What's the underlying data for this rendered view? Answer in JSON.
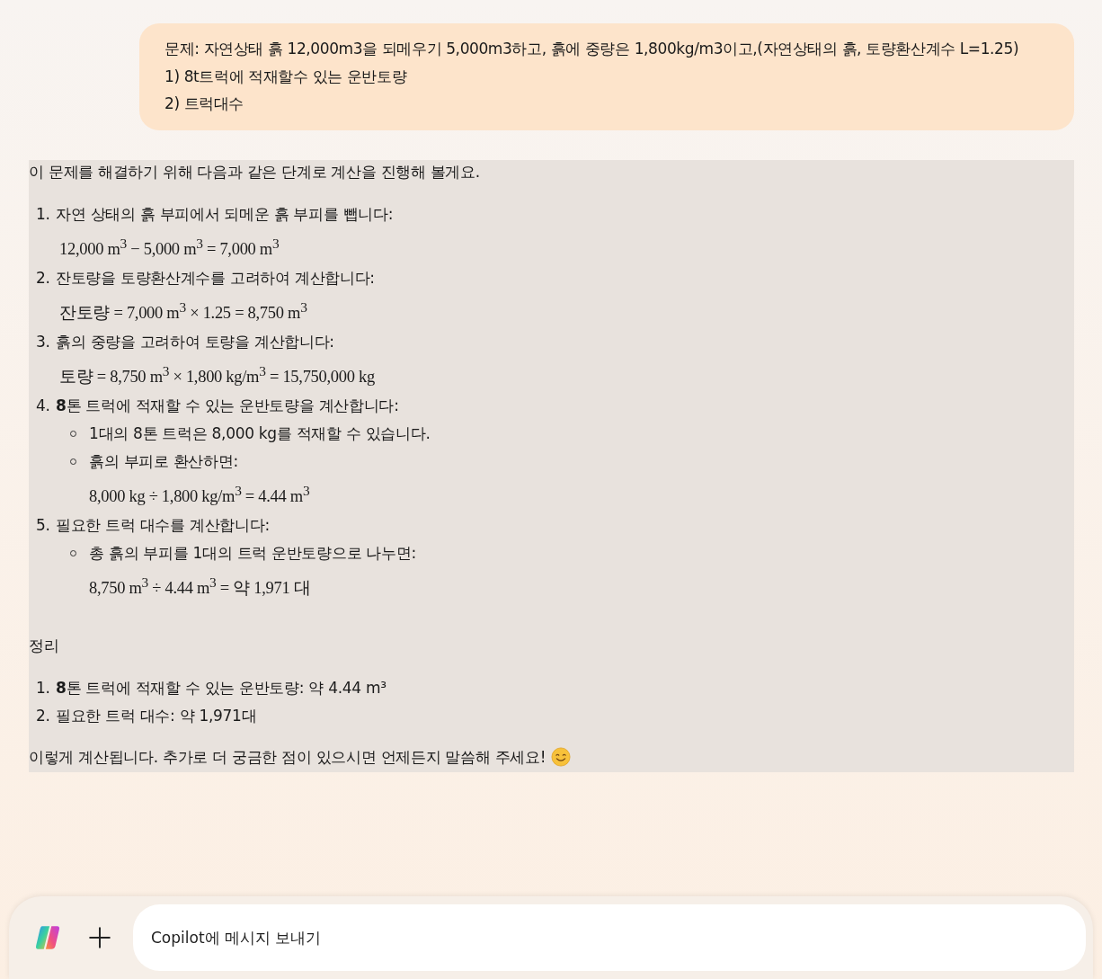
{
  "user_message": {
    "lines": [
      "문제: 자연상태 흙 12,000m3을 되메우기 5,000m3하고, 흙에 중량은 1,800kg/m3이고,(자연상태의 흙, 토량환산계수 L=1.25)",
      "1) 8t트럭에 적재할수 있는 운반토량",
      "2) 트럭대수"
    ]
  },
  "response": {
    "intro": "이 문제를 해결하기 위해 다음과 같은 단계로 계산을 진행해 볼게요.",
    "steps": [
      {
        "number": "1.",
        "text": "자연 상태의 흙 부피에서 되메운 흙 부피를 뺍니다:",
        "formula": "12,000 m$^{3}$ − 5,000 m$^{3}$ = 7,000 m$^{3}$"
      },
      {
        "number": "2.",
        "text": "잔토량을 토량환산계수를 고려하여 계산합니다:",
        "formula": "잔토량 = 7,000 m$^{3}$ × 1.25 = 8,750 m$^{3}$"
      },
      {
        "number": "3.",
        "text": "흙의 중량을 고려하여 토량을 계산합니다:",
        "formula": "토량 = 8,750 m$^{3}$ × 1,800 kg/m$^{3}$ = 15,750,000 kg"
      },
      {
        "number": "4.",
        "text": "**8**톤 트럭에 적재할 수 있는 운반토량을 계산합니다:",
        "bullets": [
          {
            "text": "1대의 8톤 트럭은 8,000 kg를 적재할 수 있습니다."
          },
          {
            "text": "흙의 부피로 환산하면:",
            "formula": "8,000 kg ÷ 1,800 kg/m$^{3}$ = 4.44 m$^{3}$"
          }
        ]
      },
      {
        "number": "5.",
        "text": "필요한 트럭 대수를 계산합니다:",
        "bullets": [
          {
            "text": "총 흙의 부피를 1대의 트럭 운반토량으로 나누면:",
            "formula": "8,750 m$^{3}$ ÷ 4.44 m$^{3}$ = 약 1,971 대"
          }
        ]
      }
    ],
    "summary_title": "정리",
    "summary": [
      {
        "number": "1.",
        "text": "**8**톤 트럭에 적재할 수 있는 운반토량: 약 4.44 m³"
      },
      {
        "number": "2.",
        "text": "필요한 트럭 대수: 약 1,971대"
      }
    ],
    "closing": "이렇게 계산됩니다. 추가로 더 궁금한 점이 있으시면 언제든지 말씀해 주세요!"
  },
  "composer": {
    "placeholder": "Copilot에 메시지 보내기"
  }
}
